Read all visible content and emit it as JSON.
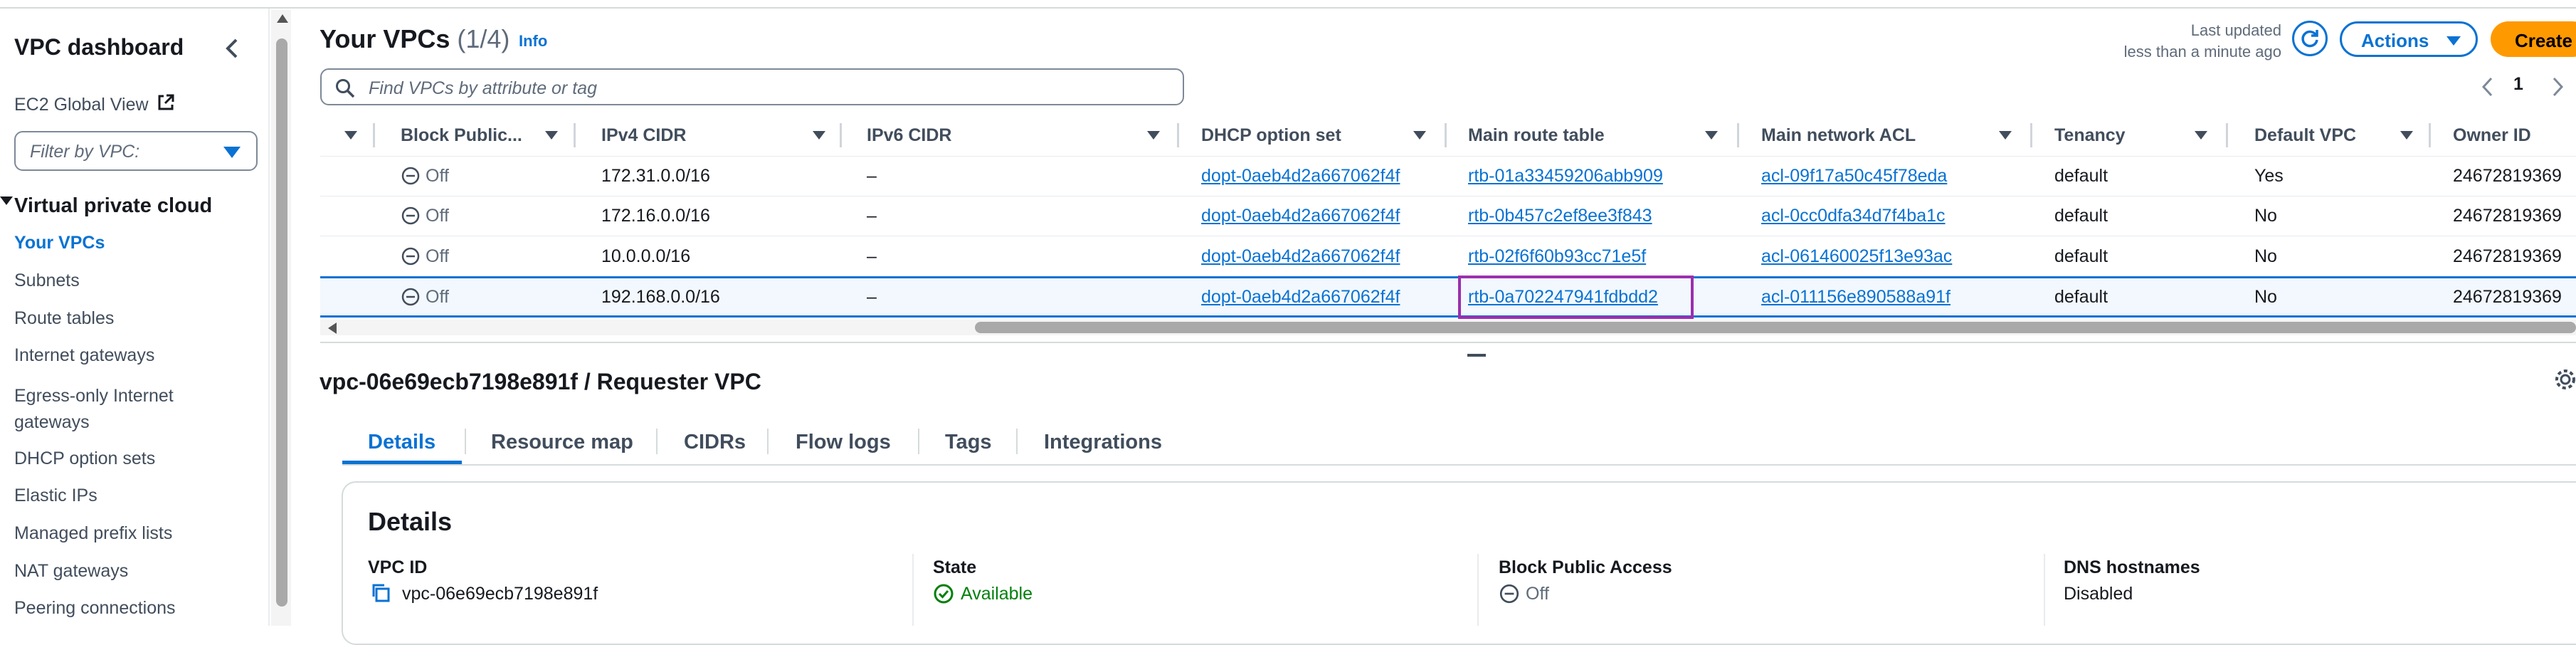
{
  "sidebar": {
    "title": "VPC dashboard",
    "ec2_global_view": "EC2 Global View",
    "filter_placeholder": "Filter by VPC:",
    "section_title": "Virtual private cloud",
    "items": [
      {
        "label": "Your VPCs",
        "active": true
      },
      {
        "label": "Subnets"
      },
      {
        "label": "Route tables"
      },
      {
        "label": "Internet gateways"
      },
      {
        "label": "Egress-only Internet gateways"
      },
      {
        "label": "DHCP option sets"
      },
      {
        "label": "Elastic IPs"
      },
      {
        "label": "Managed prefix lists"
      },
      {
        "label": "NAT gateways"
      },
      {
        "label": "Peering connections"
      }
    ]
  },
  "header": {
    "title": "Your VPCs",
    "count": "(1/4)",
    "info": "Info",
    "last_updated_label": "Last updated",
    "last_updated_value": "less than a minute ago",
    "actions_label": "Actions",
    "create_label": "Create",
    "page_number": "1"
  },
  "search": {
    "placeholder": "Find VPCs by attribute or tag"
  },
  "table": {
    "columns": [
      "Block Public...",
      "IPv4 CIDR",
      "IPv6 CIDR",
      "DHCP option set",
      "Main route table",
      "Main network ACL",
      "Tenancy",
      "Default VPC",
      "Owner ID"
    ],
    "rows": [
      {
        "block": "Off",
        "ipv4": "172.31.0.0/16",
        "ipv6": "–",
        "dhcp": "dopt-0aeb4d2a667062f4f",
        "route": "rtb-01a33459206abb909",
        "acl": "acl-09f17a50c45f78eda",
        "tenancy": "default",
        "default": "Yes",
        "owner": "24672819369"
      },
      {
        "block": "Off",
        "ipv4": "172.16.0.0/16",
        "ipv6": "–",
        "dhcp": "dopt-0aeb4d2a667062f4f",
        "route": "rtb-0b457c2ef8ee3f843",
        "acl": "acl-0cc0dfa34d7f4ba1c",
        "tenancy": "default",
        "default": "No",
        "owner": "24672819369"
      },
      {
        "block": "Off",
        "ipv4": "10.0.0.0/16",
        "ipv6": "–",
        "dhcp": "dopt-0aeb4d2a667062f4f",
        "route": "rtb-02f6f60b93cc71e5f",
        "acl": "acl-061460025f13e93ac",
        "tenancy": "default",
        "default": "No",
        "owner": "24672819369"
      },
      {
        "block": "Off",
        "ipv4": "192.168.0.0/16",
        "ipv6": "–",
        "dhcp": "dopt-0aeb4d2a667062f4f",
        "route": "rtb-0a702247941fdbdd2",
        "acl": "acl-011156e890588a91f",
        "tenancy": "default",
        "default": "No",
        "owner": "24672819369"
      }
    ]
  },
  "detail": {
    "title": "vpc-06e69ecb7198e891f / Requester VPC",
    "tabs": [
      "Details",
      "Resource map",
      "CIDRs",
      "Flow logs",
      "Tags",
      "Integrations"
    ],
    "card_title": "Details",
    "fields": [
      {
        "label": "VPC ID",
        "value": "vpc-06e69ecb7198e891f"
      },
      {
        "label": "State",
        "value": "Available"
      },
      {
        "label": "Block Public Access",
        "value": "Off"
      },
      {
        "label": "DNS hostnames",
        "value": "Disabled"
      }
    ]
  },
  "colors": {
    "link": "#0972d3",
    "accent": "#ff9900",
    "highlight": "#9b2fae",
    "success": "#037f0c"
  },
  "icons": [
    "collapse-chevron-icon",
    "external-link-icon",
    "caret-down-icon",
    "search-icon",
    "refresh-icon",
    "chevron-left-icon",
    "chevron-right-icon",
    "minus-circle-icon",
    "copy-icon",
    "check-circle-icon",
    "settings-gear-icon"
  ]
}
